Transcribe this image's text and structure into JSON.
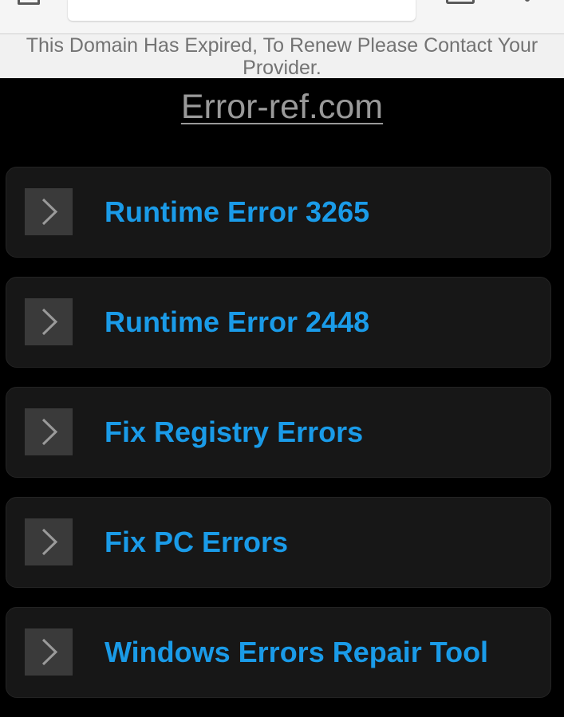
{
  "browser": {
    "url_value": ""
  },
  "banner": {
    "text": "This Domain Has Expired, To Renew Please Contact Your Provider."
  },
  "site": {
    "title": "Error-ref.com"
  },
  "links": [
    {
      "label": "Runtime Error 3265",
      "icon": "chevron-right-icon"
    },
    {
      "label": "Runtime Error 2448",
      "icon": "chevron-right-icon"
    },
    {
      "label": "Fix Registry Errors",
      "icon": "chevron-right-icon"
    },
    {
      "label": "Fix PC Errors",
      "icon": "chevron-right-icon"
    },
    {
      "label": "Windows Errors Repair Tool",
      "icon": "chevron-right-icon"
    }
  ],
  "colors": {
    "link_text": "#1a9be8",
    "card_background": "#171717",
    "page_background": "#000000"
  }
}
